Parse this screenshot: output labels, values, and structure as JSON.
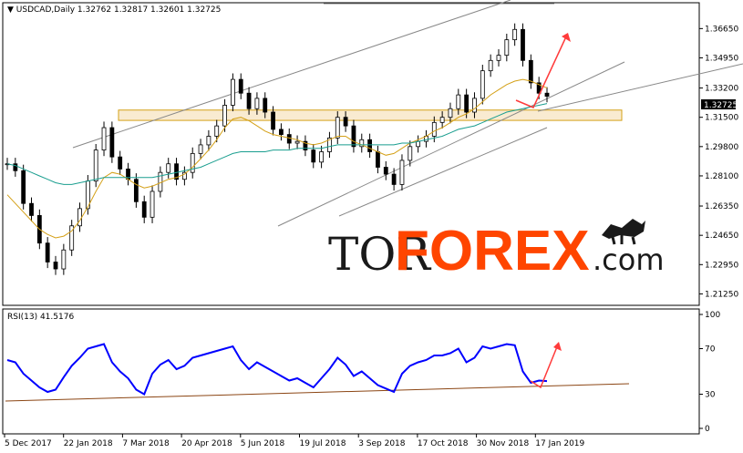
{
  "header": {
    "symbol_line": "USDCAD,Daily  1.32762 1.32817 1.32601 1.32725",
    "rsi_label": "RSI(13) 41.5176"
  },
  "price_tag": "1.32725",
  "watermark": {
    "part1": "TOR",
    "part2": "FOREX",
    "part3": ".com",
    "logo_icon": "bull-bear-icon"
  },
  "colors": {
    "up_candle": "#000000",
    "down_candle": "#000000",
    "ma_fast": "#d4a017",
    "ma_slow": "#1a9e8f",
    "rsi_line": "#0000ff",
    "arrow": "#ff3b3b",
    "zone": "#f5deb3",
    "watermark_dark": "#1a1a1a",
    "watermark_accent": "#ff4500",
    "trend_line": "#8b4513"
  },
  "chart_data": [
    {
      "type": "line",
      "title": "USDCAD,Daily",
      "instrument": "USDCAD",
      "timeframe": "Daily",
      "ohlc_last": {
        "open": 1.32762,
        "high": 1.32817,
        "low": 1.32601,
        "close": 1.32725
      },
      "y_ticks": [
        "1.36650",
        "1.34950",
        "1.33200",
        "1.31500",
        "1.29800",
        "1.28100",
        "1.26350",
        "1.24650",
        "1.22950",
        "1.21250"
      ],
      "x_ticks": [
        "5 Dec 2017",
        "22 Jan 2018",
        "7 Mar 2018",
        "20 Apr 2018",
        "5 Jun 2018",
        "19 Jul 2018",
        "3 Sep 2018",
        "17 Oct 2018",
        "30 Nov 2018",
        "17 Jan 2019"
      ],
      "ylim": [
        1.2085,
        1.3725
      ],
      "series": [
        {
          "key": "price",
          "values": [
            1.288,
            1.284,
            1.265,
            1.258,
            1.242,
            1.231,
            1.227,
            1.238,
            1.252,
            1.262,
            1.278,
            1.296,
            1.309,
            1.292,
            1.285,
            1.279,
            1.266,
            1.257,
            1.272,
            1.283,
            1.288,
            1.279,
            1.283,
            1.294,
            1.299,
            1.304,
            1.31,
            1.322,
            1.337,
            1.329,
            1.32,
            1.326,
            1.318,
            1.308,
            1.305,
            1.3,
            1.301,
            1.296,
            1.289,
            1.295,
            1.303,
            1.315,
            1.31,
            1.298,
            1.302,
            1.295,
            1.286,
            1.282,
            1.276,
            1.29,
            1.298,
            1.301,
            1.304,
            1.312,
            1.315,
            1.32,
            1.328,
            1.318,
            1.326,
            1.342,
            1.348,
            1.351,
            1.36,
            1.366,
            1.348,
            1.335,
            1.329,
            1.3272
          ]
        },
        {
          "key": "ma_fast",
          "values": [
            1.27,
            1.265,
            1.26,
            1.255,
            1.25,
            1.247,
            1.245,
            1.246,
            1.249,
            1.255,
            1.263,
            1.272,
            1.28,
            1.283,
            1.282,
            1.279,
            1.276,
            1.274,
            1.275,
            1.277,
            1.279,
            1.28,
            1.282,
            1.286,
            1.291,
            1.296,
            1.302,
            1.309,
            1.314,
            1.315,
            1.313,
            1.31,
            1.307,
            1.305,
            1.304,
            1.303,
            1.302,
            1.3,
            1.299,
            1.3,
            1.302,
            1.304,
            1.304,
            1.301,
            1.299,
            1.297,
            1.295,
            1.293,
            1.294,
            1.297,
            1.3,
            1.302,
            1.304,
            1.307,
            1.309,
            1.312,
            1.315,
            1.317,
            1.32,
            1.324,
            1.328,
            1.331,
            1.334,
            1.336,
            1.337,
            1.336,
            1.334,
            1.332
          ]
        },
        {
          "key": "ma_slow",
          "values": [
            1.288,
            1.287,
            1.285,
            1.283,
            1.281,
            1.279,
            1.277,
            1.276,
            1.276,
            1.277,
            1.278,
            1.279,
            1.28,
            1.28,
            1.28,
            1.28,
            1.28,
            1.28,
            1.28,
            1.281,
            1.282,
            1.283,
            1.284,
            1.285,
            1.286,
            1.288,
            1.29,
            1.292,
            1.294,
            1.295,
            1.295,
            1.295,
            1.295,
            1.296,
            1.296,
            1.296,
            1.297,
            1.297,
            1.297,
            1.297,
            1.298,
            1.299,
            1.299,
            1.299,
            1.299,
            1.299,
            1.299,
            1.299,
            1.299,
            1.3,
            1.3,
            1.301,
            1.302,
            1.303,
            1.304,
            1.306,
            1.308,
            1.309,
            1.31,
            1.312,
            1.314,
            1.316,
            1.318,
            1.319,
            1.32,
            1.321,
            1.322,
            1.323
          ]
        }
      ],
      "zone": {
        "y_low": 1.3132,
        "y_high": 1.3192
      }
    },
    {
      "type": "line",
      "title": "RSI(13) 41.5176",
      "y_ticks": [
        "100",
        "70",
        "30",
        "0"
      ],
      "ylim": [
        0,
        100
      ],
      "series": [
        {
          "key": "rsi",
          "values": [
            60,
            58,
            48,
            42,
            36,
            32,
            34,
            45,
            55,
            62,
            70,
            72,
            74,
            58,
            50,
            44,
            34,
            30,
            48,
            56,
            60,
            52,
            55,
            62,
            64,
            66,
            68,
            70,
            72,
            60,
            52,
            58,
            54,
            50,
            46,
            42,
            44,
            40,
            36,
            44,
            52,
            62,
            56,
            46,
            50,
            44,
            38,
            35,
            32,
            48,
            55,
            58,
            60,
            64,
            64,
            66,
            70,
            58,
            62,
            72,
            70,
            72,
            74,
            73,
            50,
            40,
            42,
            41.5
          ]
        }
      ]
    }
  ]
}
